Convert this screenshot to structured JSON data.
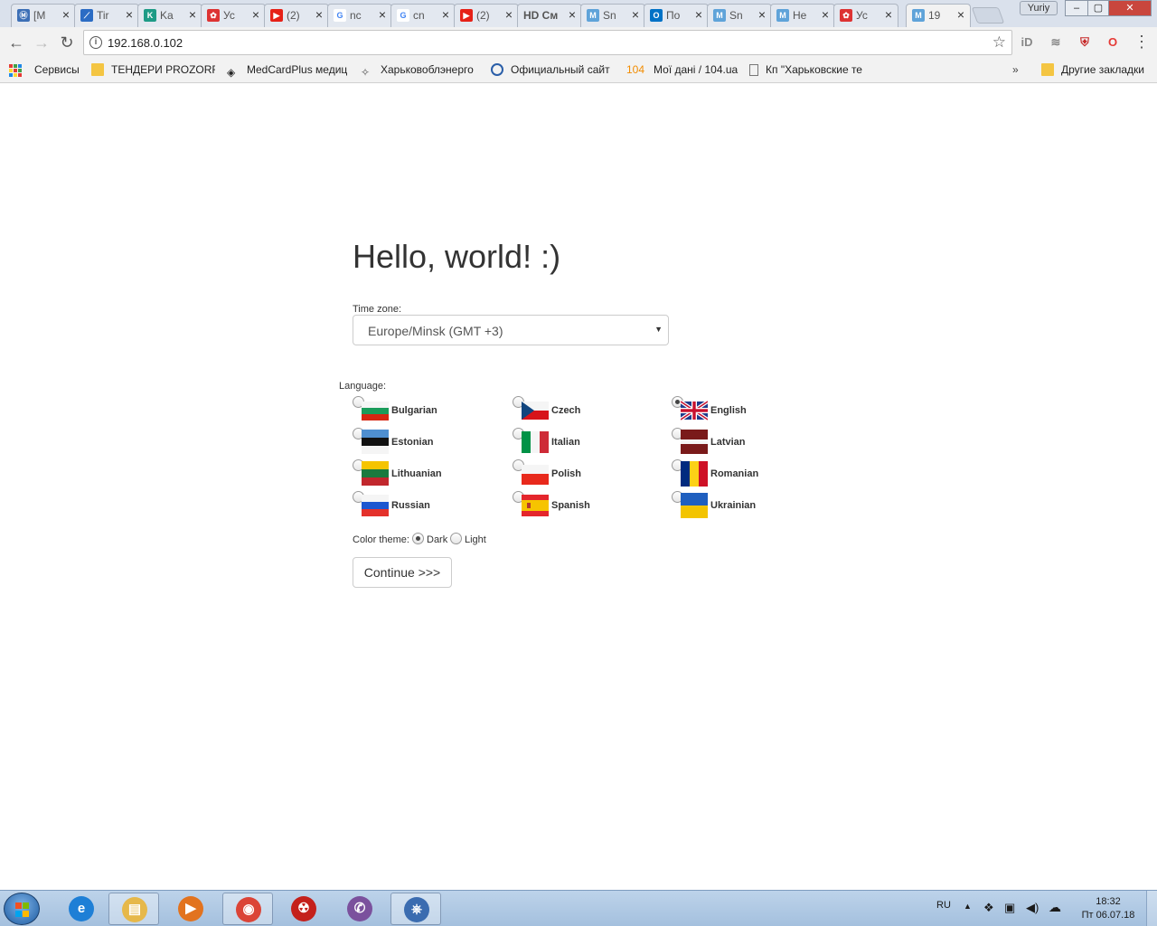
{
  "browser": {
    "tabs": [
      {
        "icon": "ministry-icon",
        "label": "[M",
        "color": "#3c6fb6",
        "glyph": "Ⓜ"
      },
      {
        "icon": "trello-like-icon",
        "label": "Tir",
        "color": "#2b6cc4",
        "glyph": "⟋"
      },
      {
        "icon": "ka-icon",
        "label": "Ka",
        "color": "#1e9b86",
        "glyph": "K"
      },
      {
        "icon": "puzzle-icon",
        "label": "Ус",
        "color": "#d33",
        "glyph": "✿"
      },
      {
        "icon": "youtube-icon",
        "label": "(2)",
        "color": "#e62117",
        "glyph": "▶"
      },
      {
        "icon": "google-icon",
        "label": "nc",
        "color": "#ffffff",
        "glyph": "G"
      },
      {
        "icon": "google-icon",
        "label": "cn",
        "color": "#ffffff",
        "glyph": "G"
      },
      {
        "icon": "youtube-icon",
        "label": "(2)",
        "color": "#e62117",
        "glyph": "▶"
      },
      {
        "icon": "hd-icon",
        "label": "HD Cм",
        "color": "#f2f2f2",
        "glyph": ""
      },
      {
        "icon": "m-icon",
        "label": "Sn",
        "color": "#5fa3d9",
        "glyph": "M"
      },
      {
        "icon": "outlook-icon",
        "label": "По",
        "color": "#0072c6",
        "glyph": "O"
      },
      {
        "icon": "m-icon",
        "label": "Sn",
        "color": "#5fa3d9",
        "glyph": "M"
      },
      {
        "icon": "m-icon",
        "label": "He",
        "color": "#5fa3d9",
        "glyph": "M"
      },
      {
        "icon": "puzzle-icon",
        "label": "Ус",
        "color": "#d33",
        "glyph": "✿"
      },
      {
        "icon": "m-icon",
        "label": "19",
        "color": "#5fa3d9",
        "glyph": "M"
      }
    ],
    "profile_name": "Yuriy",
    "url": "192.168.0.102",
    "bookmarks": [
      {
        "label": "Сервисы",
        "icon": "apps-grid-icon"
      },
      {
        "label": "ТЕНДЕРИ PROZORRO",
        "icon": "folder-icon"
      },
      {
        "label": "MedCardPlus медиц",
        "icon": "medcard-icon"
      },
      {
        "label": "Харьковоблэнерго",
        "icon": "energy-icon"
      },
      {
        "label": "Официальный сайт",
        "icon": "official-site-icon"
      },
      {
        "label": "Мої дані / 104.ua",
        "icon": "104-icon",
        "badge": "104"
      },
      {
        "label": "Кп \"Харьковские те",
        "icon": "page-icon"
      },
      {
        "label": "Другие закладки",
        "icon": "folder-icon"
      }
    ],
    "overflow": "»"
  },
  "page": {
    "heading": "Hello, world! :)",
    "timezone_label": "Time zone:",
    "timezone_value": "Europe/Minsk (GMT +3)",
    "language_label": "Language:",
    "languages": [
      {
        "name": "Bulgarian",
        "checked": false
      },
      {
        "name": "Czech",
        "checked": false
      },
      {
        "name": "English",
        "checked": true
      },
      {
        "name": "Estonian",
        "checked": false
      },
      {
        "name": "Italian",
        "checked": false
      },
      {
        "name": "Latvian",
        "checked": false
      },
      {
        "name": "Lithuanian",
        "checked": false
      },
      {
        "name": "Polish",
        "checked": false
      },
      {
        "name": "Romanian",
        "checked": false
      },
      {
        "name": "Russian",
        "checked": false
      },
      {
        "name": "Spanish",
        "checked": false
      },
      {
        "name": "Ukrainian",
        "checked": false
      }
    ],
    "theme_label": "Color theme:",
    "theme_options": [
      {
        "name": "Dark",
        "checked": true
      },
      {
        "name": "Light",
        "checked": false
      }
    ],
    "continue_label": "Continue >>>"
  },
  "taskbar": {
    "apps": [
      {
        "name": "internet-explorer-icon",
        "glyph": "e",
        "color": "#1e7fd6",
        "open": false
      },
      {
        "name": "file-explorer-icon",
        "glyph": "▤",
        "color": "#e6b84a",
        "open": true
      },
      {
        "name": "media-player-icon",
        "glyph": "▶",
        "color": "#e2731f",
        "open": false
      },
      {
        "name": "chrome-icon",
        "glyph": "◉",
        "color": "#db4437",
        "open": true
      },
      {
        "name": "ccleaner-icon",
        "glyph": "☢",
        "color": "#c4201b",
        "open": false
      },
      {
        "name": "viber-icon",
        "glyph": "✆",
        "color": "#7b519d",
        "open": false
      },
      {
        "name": "network-app-icon",
        "glyph": "⎈",
        "color": "#3b6cb0",
        "open": true
      }
    ],
    "lang": "RU",
    "time": "18:32",
    "date": "Пт 06.07.18"
  }
}
